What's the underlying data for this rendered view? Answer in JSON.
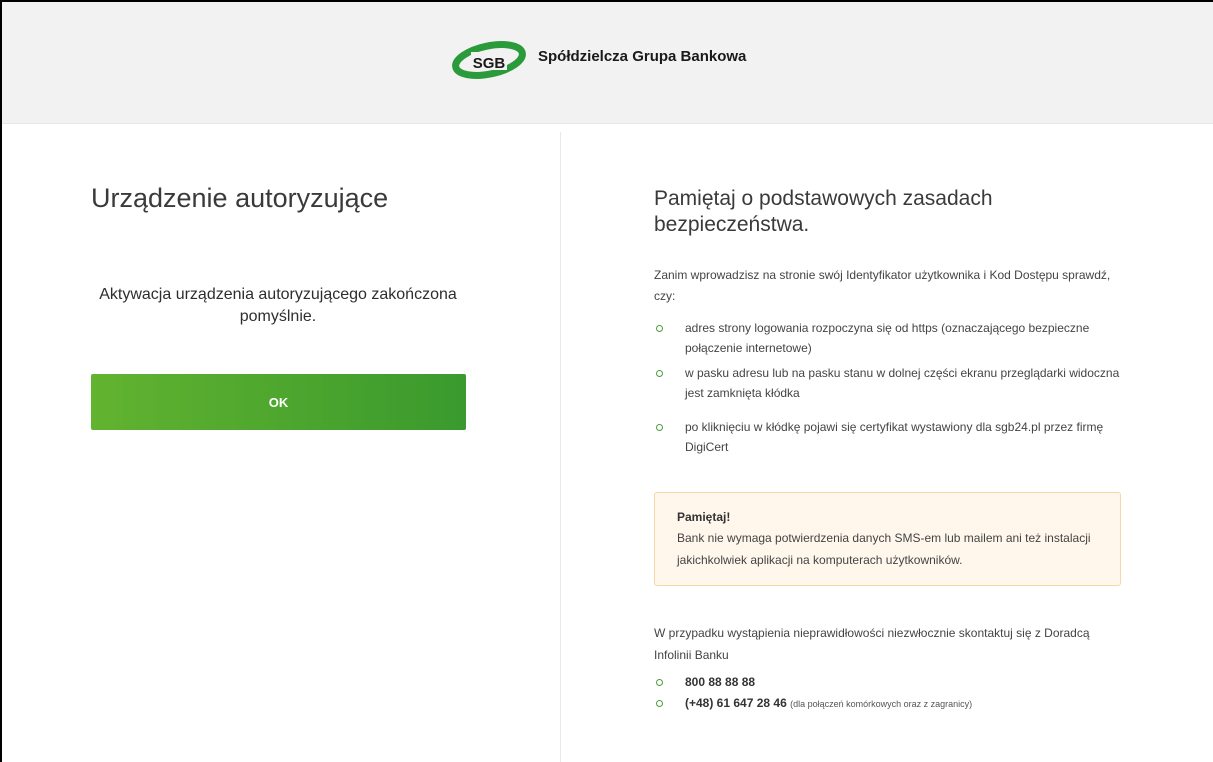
{
  "header": {
    "logo_text": "SGB",
    "brand_name": "Spółdzielcza Grupa Bankowa",
    "brand_color": "#2a9a3a"
  },
  "left": {
    "title": "Urządzenie autoryzujące",
    "message": "Aktywacja urządzenia autoryzującego zakończona pomyślnie.",
    "ok_label": "OK"
  },
  "right": {
    "title": "Pamiętaj o podstawowych zasadach bezpieczeństwa.",
    "intro": "Zanim wprowadzisz na stronie swój Identyfikator użytkownika i Kod Dostępu sprawdź, czy:",
    "tips": [
      "adres strony logowania rozpoczyna się od https (oznaczającego bezpieczne połączenie internetowe)",
      "w pasku adresu lub na pasku stanu w dolnej części ekranu przeglądarki widoczna jest zamknięta kłódka",
      "po kliknięciu w kłódkę pojawi się certyfikat wystawiony dla sgb24.pl przez firmę DigiCert"
    ],
    "note": {
      "title": "Pamiętaj!",
      "text": "Bank nie wymaga potwierdzenia danych SMS-em lub mailem ani też instalacji jakichkolwiek aplikacji na komputerach użytkowników."
    },
    "contact_text": "W przypadku wystąpienia nieprawidłowości niezwłocznie skontaktuj się z Doradcą Infolinii Banku",
    "phones": [
      {
        "number": "800 88 88 88",
        "note": ""
      },
      {
        "number": "(+48) 61 647 28 46",
        "note": "(dla połączeń komórkowych oraz z zagranicy)"
      }
    ]
  },
  "colors": {
    "accent_green": "#4aa534",
    "header_bg": "#f2f2f2",
    "note_bg": "#fff7ec",
    "note_border": "#f5d7a8"
  }
}
